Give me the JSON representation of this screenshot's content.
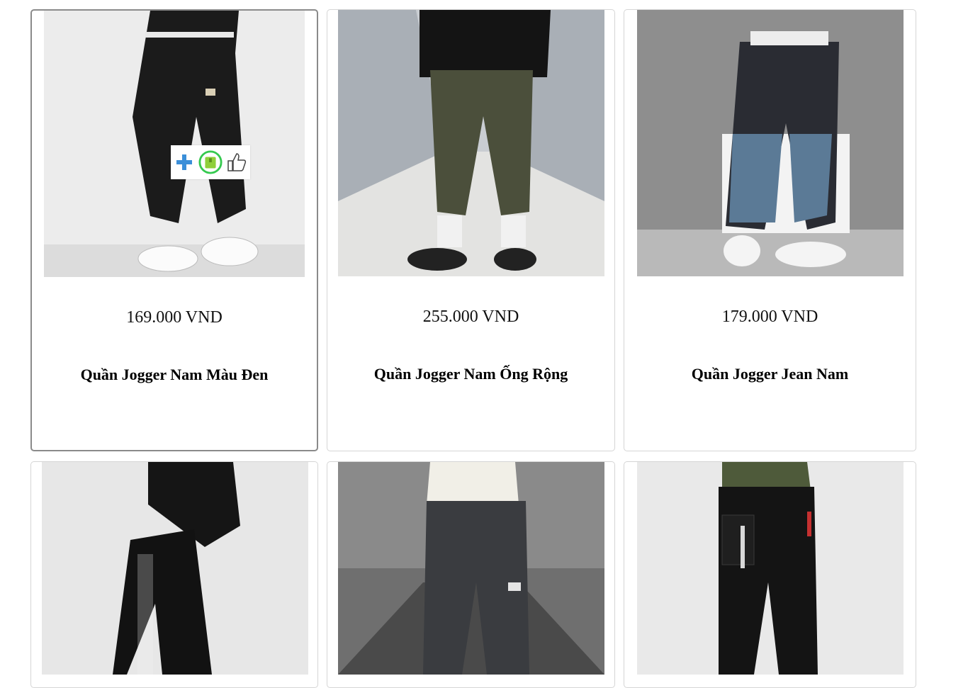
{
  "products": [
    {
      "price": "169.000 VND",
      "name": "Quần Jogger Nam Màu Đen"
    },
    {
      "price": "255.000 VND",
      "name": "Quần Jogger Nam Ống Rộng"
    },
    {
      "price": "179.000 VND",
      "name": "Quần Jogger Jean Nam"
    },
    {
      "price": "",
      "name": ""
    },
    {
      "price": "",
      "name": ""
    },
    {
      "price": "",
      "name": ""
    }
  ],
  "overlay": {
    "icons": [
      "plus-icon",
      "bag-icon",
      "thumbs-up-icon"
    ]
  },
  "colors": {
    "plus": "#3b8fd9",
    "bag_ring": "#35c94f",
    "bag_fill": "#8fcf3a",
    "card_border": "#d5d5d5",
    "active_border": "#8a8a8a"
  }
}
